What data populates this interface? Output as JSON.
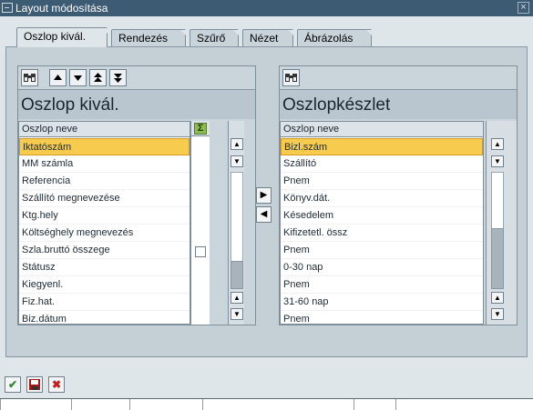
{
  "window": {
    "title": "Layout módosítása",
    "close_glyph": "×"
  },
  "tabs": [
    {
      "label": "Oszlop kivál."
    },
    {
      "label": "Rendezés"
    },
    {
      "label": "Szűrő"
    },
    {
      "label": "Nézet"
    },
    {
      "label": "Ábrázolás"
    }
  ],
  "left": {
    "title": "Oszlop kivál.",
    "column_header": "Oszlop neve",
    "items": [
      "Iktatószám",
      "MM számla",
      "Referencia",
      "Szállító megnevezése",
      "Ktg.hely",
      "Költséghely megnevezés",
      "Szla.bruttó összege",
      "Státusz",
      "Kiegyenl.",
      "Fiz.hat.",
      "Biz.dátum"
    ],
    "selected_index": 0
  },
  "right": {
    "title": "Oszlopkészlet",
    "column_header": "Oszlop neve",
    "items": [
      "Bizl.szám",
      "Szállító",
      "Pnem",
      "Könyv.dát.",
      "Késedelem",
      "Kifizetetl. össz",
      "Pnem",
      "0-30 nap",
      "Pnem",
      "31-60 nap",
      "Pnem"
    ],
    "selected_index": 0
  },
  "icons": {
    "find": "find-icon",
    "move_up": "arrow-up-icon",
    "move_down": "arrow-down-icon",
    "move_top": "double-arrow-up-icon",
    "move_bottom": "double-arrow-down-icon",
    "sum": "sigma-icon",
    "move_right": "arrow-right-icon",
    "move_left": "arrow-left-icon",
    "confirm": "check-icon",
    "save": "save-icon",
    "cancel": "cancel-icon"
  },
  "colors": {
    "title_bar": "#3d5b73",
    "selection": "#f7cb4d",
    "confirm_green": "#2e8b2e",
    "cancel_red": "#c41e1e"
  }
}
